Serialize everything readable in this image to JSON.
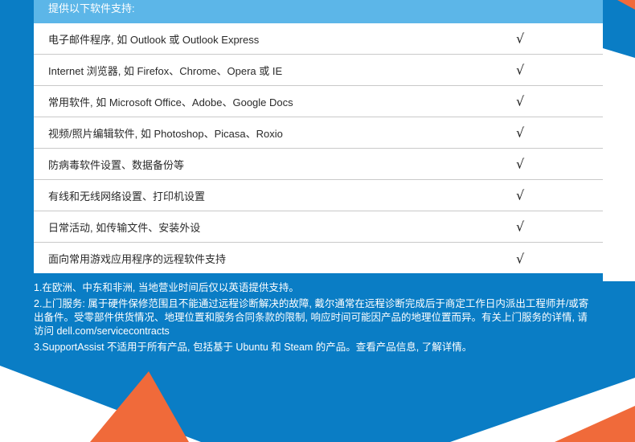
{
  "header": "提供以下软件支持:",
  "check_mark": "√",
  "rows": [
    "电子邮件程序, 如 Outlook 或 Outlook Express",
    "Internet 浏览器, 如 Firefox、Chrome、Opera 或 IE",
    "常用软件, 如 Microsoft Office、Adobe、Google Docs",
    "视频/照片编辑软件, 如 Photoshop、Picasa、Roxio",
    "防病毒软件设置、数据备份等",
    "有线和无线网络设置、打印机设置",
    "日常活动, 如传输文件、安装外设",
    "面向常用游戏应用程序的远程软件支持"
  ],
  "notes": [
    "1.在欧洲、中东和非洲, 当地营业时间后仅以英语提供支持。",
    "2.上门服务: 属于硬件保修范围且不能通过远程诊断解决的故障, 戴尔通常在远程诊断完成后于商定工作日内派出工程师并/或寄出备件。受零部件供货情况、地理位置和服务合同条款的限制, 响应时间可能因产品的地理位置而异。有关上门服务的详情, 请访问 dell.com/servicecontracts",
    "3.SupportAssist 不适用于所有产品, 包括基于 Ubuntu 和 Steam 的产品。查看产品信息, 了解详情。"
  ],
  "colors": {
    "background_blue": "#0a7dc5",
    "header_blue": "#5cb6e8",
    "accent_orange": "#f06a3a"
  }
}
